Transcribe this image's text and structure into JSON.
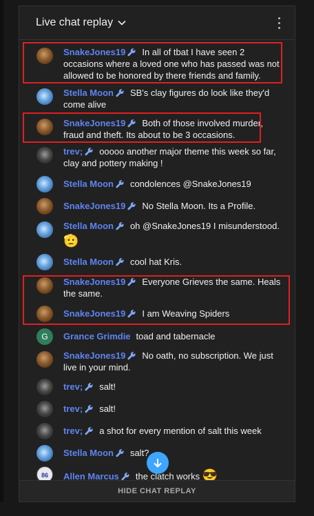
{
  "header": {
    "title": "Live chat replay"
  },
  "messages": [
    {
      "author": "SnakeJones19",
      "text": "In all of tbat I have seen 2 occasions where a loved one who has passed was not allowed to be honored by there friends and family.",
      "avatar": "snake"
    },
    {
      "author": "Stella Moon",
      "text": "SB's clay figures do look like they'd come alive",
      "avatar": "stella"
    },
    {
      "author": "SnakeJones19",
      "text": "Both of those involved murder, fraud and theft. Its about to be 3 occasions.",
      "avatar": "snake"
    },
    {
      "author": "trev;",
      "text": "ooooo another major theme this week so far, clay and pottery making !",
      "avatar": "trev"
    },
    {
      "author": "Stella Moon",
      "text": "condolences @SnakeJones19",
      "avatar": "stella"
    },
    {
      "author": "SnakeJones19",
      "text": "No Stella Moon. Its a Profile.",
      "avatar": "snake"
    },
    {
      "author": "Stella Moon",
      "text": "oh @SnakeJones19 I misunderstood.",
      "emoji": "🫡",
      "avatar": "stella"
    },
    {
      "author": "Stella Moon",
      "text": "cool hat Kris.",
      "avatar": "stella"
    },
    {
      "author": "SnakeJones19",
      "text": "Everyone Grieves the same. Heals the same.",
      "avatar": "snake"
    },
    {
      "author": "SnakeJones19",
      "text": "I am Weaving Spiders",
      "avatar": "snake"
    },
    {
      "author": "Grance Grimdie",
      "text": "toad and tabernacle",
      "avatar": "G"
    },
    {
      "author": "SnakeJones19",
      "text": "No oath, no subscription. We just live in your mind.",
      "avatar": "snake"
    },
    {
      "author": "trev;",
      "text": "salt!",
      "avatar": "trev"
    },
    {
      "author": "trev;",
      "text": "salt!",
      "avatar": "trev"
    },
    {
      "author": "trev;",
      "text": "a shot for every mention of salt this week",
      "avatar": "trev"
    },
    {
      "author": "Stella Moon",
      "text": "salt?",
      "avatar": "stella"
    },
    {
      "author": "Allen Marcus",
      "text": "the clatch works",
      "emoji": "😎",
      "avatar": "86"
    }
  ],
  "footer": {
    "label": "HIDE CHAT REPLAY"
  },
  "colors": {
    "author": "#5e84f1",
    "highlight_box": "#e02020",
    "scroll_button": "#3ea6ff"
  }
}
